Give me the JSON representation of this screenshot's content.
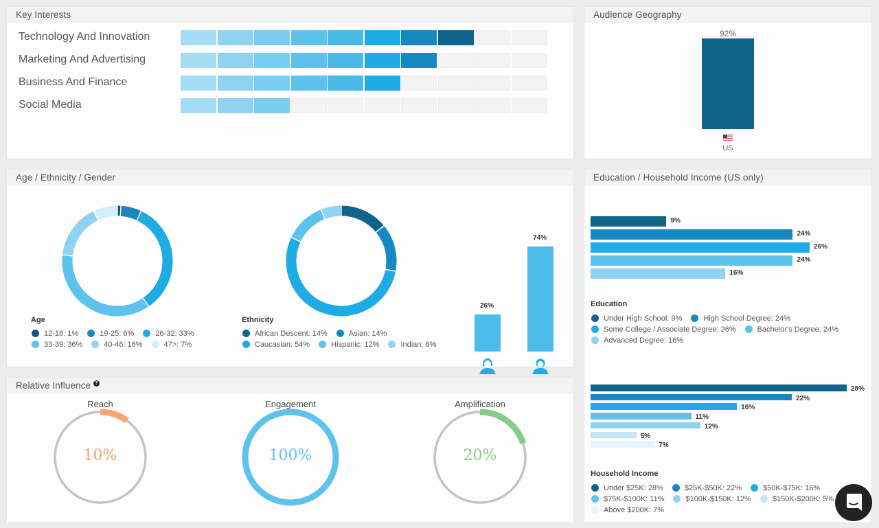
{
  "key_interests": {
    "title": "Key Interests",
    "total_segments": 10,
    "segment_colors": [
      "#a6dcf3",
      "#8fd3f1",
      "#7acdef",
      "#5ec3ec",
      "#49b9e8",
      "#1fabe3",
      "#1589c0",
      "#0f648b",
      "#f3f3f3",
      "#f3f3f3"
    ],
    "items": [
      {
        "label": "Technology And Innovation",
        "level": 8
      },
      {
        "label": "Marketing And Advertising",
        "level": 7
      },
      {
        "label": "Business And Finance",
        "level": 6
      },
      {
        "label": "Social Media",
        "level": 3
      }
    ]
  },
  "geography": {
    "title": "Audience Geography",
    "bars": [
      {
        "country": "US",
        "value_label": "92%",
        "value": 92,
        "flag": "us-flag-icon"
      }
    ],
    "color": "#10648a"
  },
  "demographics": {
    "title": "Age / Ethnicity / Gender",
    "age": {
      "legend_title": "Age",
      "items": [
        {
          "label": "12-18: 1%",
          "value": 1,
          "color": "#10587d"
        },
        {
          "label": "19-25: 6%",
          "value": 6,
          "color": "#1b86ba"
        },
        {
          "label": "26-32: 33%",
          "value": 33,
          "color": "#1fabe3"
        },
        {
          "label": "33-39: 36%",
          "value": 36,
          "color": "#5ec3ec"
        },
        {
          "label": "40-46: 16%",
          "value": 16,
          "color": "#8fd3f1"
        },
        {
          "label": "47>: 7%",
          "value": 7,
          "color": "#d2eefa"
        }
      ]
    },
    "ethnicity": {
      "legend_title": "Ethnicity",
      "items": [
        {
          "label": "African Descent: 14%",
          "value": 14,
          "color": "#10648a"
        },
        {
          "label": "Asian: 14%",
          "value": 14,
          "color": "#1589c0"
        },
        {
          "label": "Caucasian: 54%",
          "value": 54,
          "color": "#1fabe3"
        },
        {
          "label": "Hispanic: 12%",
          "value": 12,
          "color": "#5ec3ec"
        },
        {
          "label": "Indian: 6%",
          "value": 6,
          "color": "#8fd3f1"
        }
      ]
    },
    "gender": {
      "bars": [
        {
          "label": "26%",
          "value": 26,
          "icon": "female-user-icon"
        },
        {
          "label": "74%",
          "value": 74,
          "icon": "male-user-icon"
        }
      ]
    }
  },
  "influence": {
    "title": "Relative Influence",
    "help_icon": "question-circle-icon",
    "gauges": [
      {
        "title": "Reach",
        "value_label": "10%",
        "value": 10,
        "color": "#f7a56f"
      },
      {
        "title": "Engagement",
        "value_label": "100%",
        "value": 100,
        "color": "#5ec3ec"
      },
      {
        "title": "Amplification",
        "value_label": "20%",
        "value": 20,
        "color": "#88cc8c"
      }
    ],
    "track_color": "#c4c4c4"
  },
  "education_income": {
    "title": "Education / Household Income (US only)",
    "education": {
      "legend_title": "Education",
      "items": [
        {
          "label": "Under High School: 9%",
          "bar_label": "9%",
          "value": 9,
          "color": "#10648a"
        },
        {
          "label": "High School Degree: 24%",
          "bar_label": "24%",
          "value": 24,
          "color": "#1589c0"
        },
        {
          "label": "Some College / Associate Degree: 26%",
          "bar_label": "26%",
          "value": 26,
          "color": "#1fabe3"
        },
        {
          "label": "Bachelor's Degree: 24%",
          "bar_label": "24%",
          "value": 24,
          "color": "#5ec3ec"
        },
        {
          "label": "Advanced Degree: 16%",
          "bar_label": "16%",
          "value": 16,
          "color": "#8fd3f1"
        }
      ]
    },
    "income": {
      "legend_title": "Household Income",
      "items": [
        {
          "label": "Under $25K: 28%",
          "bar_label": "28%",
          "value": 28,
          "color": "#10648a"
        },
        {
          "label": "$25K-$50K: 22%",
          "bar_label": "22%",
          "value": 22,
          "color": "#1589c0"
        },
        {
          "label": "$50K-$75K: 16%",
          "bar_label": "16%",
          "value": 16,
          "color": "#1fabe3"
        },
        {
          "label": "$75K-$100K: 11%",
          "bar_label": "11%",
          "value": 11,
          "color": "#5ec3ec"
        },
        {
          "label": "$100K-$150K: 12%",
          "bar_label": "12%",
          "value": 12,
          "color": "#8fd3f1"
        },
        {
          "label": "$150K-$200K: 5%",
          "bar_label": "5%",
          "value": 5,
          "color": "#c3e7f7"
        },
        {
          "label": "Above $200K: 7%",
          "bar_label": "7%",
          "value": 7,
          "color": "#e6f5fc"
        }
      ]
    }
  },
  "chat_widget": {
    "icon": "chat-bubble-icon"
  },
  "chart_data": [
    {
      "type": "bar",
      "title": "Key Interests",
      "categories": [
        "Technology And Innovation",
        "Marketing And Advertising",
        "Business And Finance",
        "Social Media"
      ],
      "values": [
        8,
        7,
        6,
        3
      ],
      "ylim": [
        0,
        10
      ]
    },
    {
      "type": "bar",
      "title": "Audience Geography",
      "categories": [
        "US"
      ],
      "values": [
        92
      ]
    },
    {
      "type": "pie",
      "title": "Age",
      "categories": [
        "12-18",
        "19-25",
        "26-32",
        "33-39",
        "40-46",
        "47>"
      ],
      "values": [
        1,
        6,
        33,
        36,
        16,
        7
      ]
    },
    {
      "type": "pie",
      "title": "Ethnicity",
      "categories": [
        "African Descent",
        "Asian",
        "Caucasian",
        "Hispanic",
        "Indian"
      ],
      "values": [
        14,
        14,
        54,
        12,
        6
      ]
    },
    {
      "type": "bar",
      "title": "Gender",
      "categories": [
        "Female",
        "Male"
      ],
      "values": [
        26,
        74
      ]
    },
    {
      "type": "bar",
      "title": "Education",
      "categories": [
        "Under High School",
        "High School Degree",
        "Some College / Associate Degree",
        "Bachelor's Degree",
        "Advanced Degree"
      ],
      "values": [
        9,
        24,
        26,
        24,
        16
      ]
    },
    {
      "type": "bar",
      "title": "Household Income",
      "categories": [
        "Under $25K",
        "$25K-$50K",
        "$50K-$75K",
        "$75K-$100K",
        "$100K-$150K",
        "$150K-$200K",
        "Above $200K"
      ],
      "values": [
        28,
        22,
        16,
        11,
        12,
        5,
        7
      ]
    },
    {
      "type": "pie",
      "title": "Relative Influence",
      "categories": [
        "Reach",
        "Engagement",
        "Amplification"
      ],
      "values": [
        10,
        100,
        20
      ]
    }
  ]
}
